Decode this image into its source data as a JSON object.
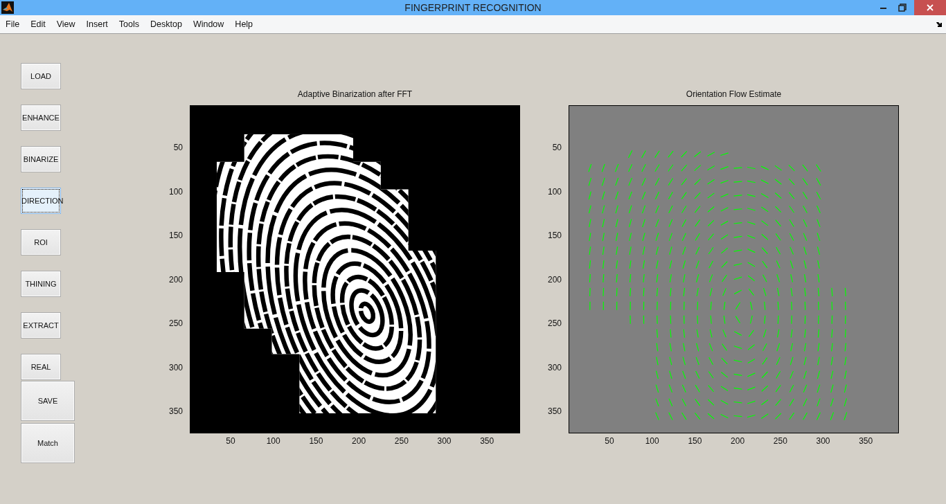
{
  "window": {
    "title": "FINGERPRINT RECOGNITION"
  },
  "menu": [
    "File",
    "Edit",
    "View",
    "Insert",
    "Tools",
    "Desktop",
    "Window",
    "Help"
  ],
  "buttons": [
    {
      "label": "LOAD",
      "kind": "small",
      "focused": false
    },
    {
      "label": "ENHANCE",
      "kind": "small",
      "focused": false
    },
    {
      "label": "BINARIZE",
      "kind": "small",
      "focused": false
    },
    {
      "label": "DIRECTION",
      "kind": "small",
      "focused": true
    },
    {
      "label": "ROI",
      "kind": "small",
      "focused": false
    },
    {
      "label": "THINING",
      "kind": "small",
      "focused": false
    },
    {
      "label": "EXTRACT",
      "kind": "small",
      "focused": false
    },
    {
      "label": "REAL",
      "kind": "small",
      "focused": false
    },
    {
      "label": "SAVE",
      "kind": "large",
      "focused": false
    },
    {
      "label": "Match",
      "kind": "large",
      "focused": false
    }
  ],
  "axes": [
    {
      "title": "Adaptive Binarization after FFT",
      "kind": "binary-image",
      "xticks": [
        "50",
        "100",
        "150",
        "200",
        "250",
        "300",
        "350"
      ],
      "yticks": [
        "50",
        "100",
        "150",
        "200",
        "250",
        "300",
        "350"
      ]
    },
    {
      "title": "Orientation Flow Estimate",
      "kind": "quiver",
      "xticks": [
        "50",
        "100",
        "150",
        "200",
        "250",
        "300",
        "350"
      ],
      "yticks": [
        "50",
        "100",
        "150",
        "200",
        "250",
        "300",
        "350"
      ]
    }
  ]
}
